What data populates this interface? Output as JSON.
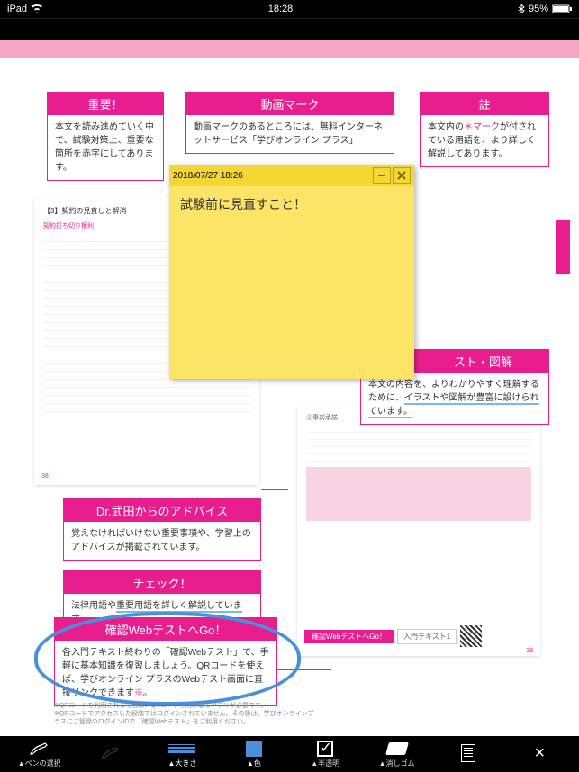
{
  "status": {
    "carrier": "iPad",
    "time": "18:28",
    "battery": "95%"
  },
  "callouts": {
    "important": {
      "title": "重要！",
      "body": "本文を読み進めていく中で、試験対策上、重要な箇所を赤字にしてあります。"
    },
    "video": {
      "title": "動画マーク",
      "body": "動画マークのあるところには、無料インターネットサービス「学びオンライン プラス」"
    },
    "note": {
      "title": "註",
      "body_pre": "本文内の",
      "body_mark": "＊マーク",
      "body_post": "が付されている用語を、より詳しく解説してあります。"
    },
    "advice": {
      "title": "Dr.武田からのアドバイス",
      "body": "覚えなければいけない重要事項や、学習上のアドバイスが掲載されています。"
    },
    "check": {
      "title": "チェック！",
      "body_pre": "法律用語や",
      "body_highlight": "重要用語を詳しく解説しています。"
    },
    "illust": {
      "title_suffix": "スト・図解",
      "body_pre": "本文の内容を、よりわかりやすく理解するために、",
      "body_highlight": "イラストや図解が豊富に設けられています。"
    },
    "webtest": {
      "title": "確認WebテストへGo！",
      "body": "各入門テキスト終わりの「確認Webテスト」で、手軽に基本知識を復習しましょう。QRコードを使えば、学びオンライン プラスのWebテスト画面に直接リンクできます",
      "asterisk": "※",
      "footer1": "※QRコードを利用される場合は、QRコードを読み取るアプリが必要です。",
      "footer2": "※QRコードでアクセスした段階ではログインされていません。その後は、学びオンラインプラスにご登録のログインIDで「確認Webテスト」をご利用ください。"
    }
  },
  "sticky": {
    "timestamp": "2018/07/27 18:26",
    "text": "試験前に見直すこと！"
  },
  "doc": {
    "section_title": "【3】契約の見直しと解消",
    "goto_label": "確認WebテストへGo！",
    "goto_target": "入門テキスト1"
  },
  "toolbar": {
    "pen": "▲ペンの選択",
    "size": "▲大きさ",
    "color": "▲色",
    "opacity": "▲半透明",
    "eraser": "▲消しゴム"
  }
}
